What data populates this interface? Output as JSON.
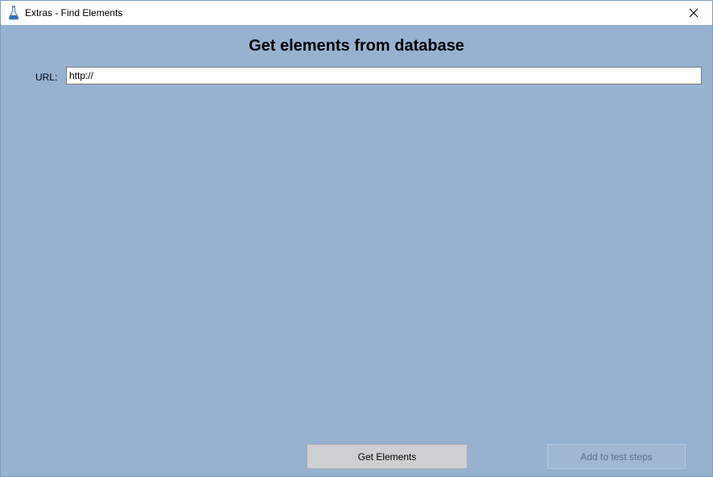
{
  "window": {
    "title": "Extras - Find Elements",
    "app_icon": "flask-icon",
    "close_icon": "close-icon",
    "background_color": "#97b1d1"
  },
  "main": {
    "heading": "Get elements from database",
    "url_label": "URL:",
    "url_value": "http://"
  },
  "buttons": {
    "get_elements": "Get Elements",
    "add_to_test_steps": "Add to test steps",
    "add_to_test_steps_disabled": true
  }
}
